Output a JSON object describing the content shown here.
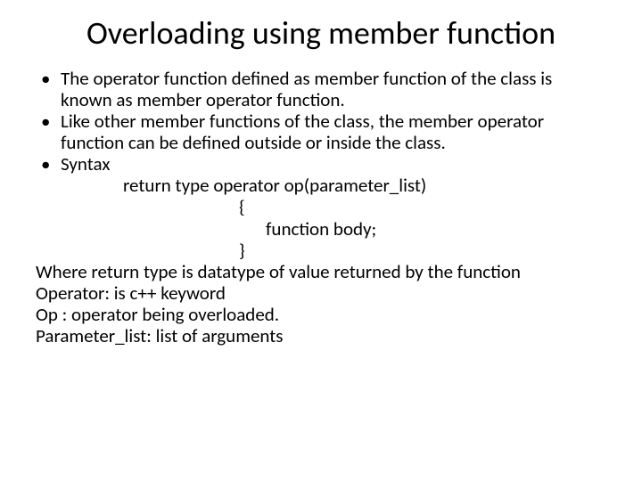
{
  "title": "Overloading using member function",
  "bullets": [
    "The operator function defined as member function of the class is known as member operator function.",
    "Like other member functions of the class, the member operator function can be defined outside or inside the class.",
    "Syntax"
  ],
  "syntax": {
    "l1": "return type operator op(parameter_list)",
    "l2": "{",
    "l3": "function body;",
    "l4": "}"
  },
  "trail": [
    "Where return type is datatype of value returned by the function",
    "Operator: is c++ keyword",
    "Op : operator being overloaded.",
    "Parameter_list: list of arguments"
  ]
}
